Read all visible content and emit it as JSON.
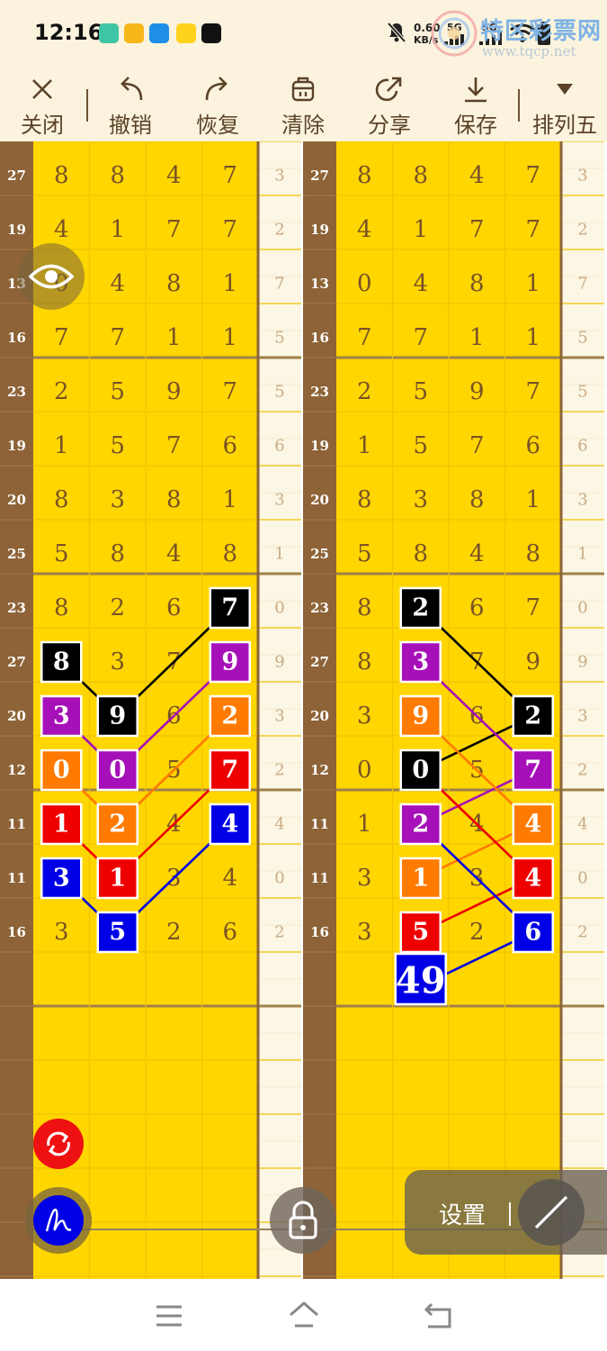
{
  "status": {
    "time": "12:16",
    "net_speed_top": "0.60",
    "net_speed_unit": "KB/s",
    "net_type_1": "5G",
    "net_type_2": "5G"
  },
  "watermark": {
    "title": "特区彩票网",
    "url": "www.tqcp.net"
  },
  "toolbar": {
    "close": "关闭",
    "undo": "撤销",
    "redo": "恢复",
    "clear": "清除",
    "share": "分享",
    "save": "保存",
    "lottery": "排列五"
  },
  "colors": {
    "board_yellow": "#ffd600",
    "label_brown": "#8a6030",
    "digit_brown": "#7a5226",
    "black": "#000000",
    "purple": "#a610b8",
    "orange": "#ff7a00",
    "red": "#ee0000",
    "blue": "#0000e6"
  },
  "grid": {
    "rows": [
      {
        "label": "27",
        "digits": [
          "8",
          "8",
          "4",
          "7"
        ],
        "tail": "3"
      },
      {
        "label": "19",
        "digits": [
          "4",
          "1",
          "7",
          "7"
        ],
        "tail": "2"
      },
      {
        "label": "13",
        "digits": [
          "0",
          "4",
          "8",
          "1"
        ],
        "tail": "7"
      },
      {
        "label": "16",
        "digits": [
          "7",
          "7",
          "1",
          "1"
        ],
        "tail": "5"
      },
      {
        "label": "23",
        "digits": [
          "2",
          "5",
          "9",
          "7"
        ],
        "tail": "5"
      },
      {
        "label": "19",
        "digits": [
          "1",
          "5",
          "7",
          "6"
        ],
        "tail": "6"
      },
      {
        "label": "20",
        "digits": [
          "8",
          "3",
          "8",
          "1"
        ],
        "tail": "3"
      },
      {
        "label": "25",
        "digits": [
          "5",
          "8",
          "4",
          "8"
        ],
        "tail": "1"
      },
      {
        "label": "23",
        "digits": [
          "8",
          "2",
          "6",
          "7"
        ],
        "tail": "0"
      },
      {
        "label": "27",
        "digits": [
          "8",
          "3",
          "7",
          "9"
        ],
        "tail": "9"
      },
      {
        "label": "20",
        "digits": [
          "3",
          "9",
          "6",
          "2"
        ],
        "tail": "3"
      },
      {
        "label": "12",
        "digits": [
          "0",
          "0",
          "5",
          "7"
        ],
        "tail": "2"
      },
      {
        "label": "11",
        "digits": [
          "1",
          "2",
          "4",
          "4"
        ],
        "tail": "4"
      },
      {
        "label": "11",
        "digits": [
          "3",
          "1",
          "3",
          "4"
        ],
        "tail": "0"
      },
      {
        "label": "16",
        "digits": [
          "3",
          "5",
          "2",
          "6"
        ],
        "tail": "2"
      }
    ]
  },
  "panel1": {
    "boxes": [
      {
        "row": 8,
        "col": 3,
        "value": "7",
        "color": "black"
      },
      {
        "row": 9,
        "col": 0,
        "value": "8",
        "color": "black"
      },
      {
        "row": 9,
        "col": 3,
        "value": "9",
        "color": "purple"
      },
      {
        "row": 10,
        "col": 0,
        "value": "3",
        "color": "purple"
      },
      {
        "row": 10,
        "col": 1,
        "value": "9",
        "color": "black"
      },
      {
        "row": 10,
        "col": 3,
        "value": "2",
        "color": "orange"
      },
      {
        "row": 11,
        "col": 0,
        "value": "0",
        "color": "orange"
      },
      {
        "row": 11,
        "col": 1,
        "value": "0",
        "color": "purple"
      },
      {
        "row": 11,
        "col": 3,
        "value": "7",
        "color": "red"
      },
      {
        "row": 12,
        "col": 0,
        "value": "1",
        "color": "red"
      },
      {
        "row": 12,
        "col": 1,
        "value": "2",
        "color": "orange"
      },
      {
        "row": 12,
        "col": 3,
        "value": "4",
        "color": "blue"
      },
      {
        "row": 13,
        "col": 0,
        "value": "3",
        "color": "blue"
      },
      {
        "row": 13,
        "col": 1,
        "value": "1",
        "color": "red"
      },
      {
        "row": 14,
        "col": 1,
        "value": "5",
        "color": "blue"
      }
    ],
    "lines": [
      {
        "color": "black",
        "path": [
          [
            9,
            0
          ],
          [
            10,
            1
          ],
          [
            8,
            3
          ]
        ]
      },
      {
        "color": "purple",
        "path": [
          [
            10,
            0
          ],
          [
            11,
            1
          ],
          [
            9,
            3
          ]
        ]
      },
      {
        "color": "orange",
        "path": [
          [
            11,
            0
          ],
          [
            12,
            1
          ],
          [
            10,
            3
          ]
        ]
      },
      {
        "color": "red",
        "path": [
          [
            12,
            0
          ],
          [
            13,
            1
          ],
          [
            11,
            3
          ]
        ]
      },
      {
        "color": "blue",
        "path": [
          [
            13,
            0
          ],
          [
            14,
            1
          ],
          [
            12,
            3
          ]
        ]
      }
    ]
  },
  "panel2": {
    "boxes": [
      {
        "row": 8,
        "col": 1,
        "value": "2",
        "color": "black"
      },
      {
        "row": 9,
        "col": 1,
        "value": "3",
        "color": "purple"
      },
      {
        "row": 10,
        "col": 1,
        "value": "9",
        "color": "orange"
      },
      {
        "row": 10,
        "col": 3,
        "value": "2",
        "color": "black"
      },
      {
        "row": 11,
        "col": 1,
        "value": "0",
        "color": "black"
      },
      {
        "row": 11,
        "col": 3,
        "value": "7",
        "color": "purple"
      },
      {
        "row": 12,
        "col": 1,
        "value": "2",
        "color": "purple"
      },
      {
        "row": 12,
        "col": 3,
        "value": "4",
        "color": "orange"
      },
      {
        "row": 13,
        "col": 1,
        "value": "1",
        "color": "orange"
      },
      {
        "row": 13,
        "col": 3,
        "value": "4",
        "color": "red"
      },
      {
        "row": 14,
        "col": 1,
        "value": "5",
        "color": "red"
      },
      {
        "row": 14,
        "col": 3,
        "value": "6",
        "color": "blue"
      }
    ],
    "lines": [
      {
        "color": "black",
        "path": [
          [
            8,
            1
          ],
          [
            10,
            3
          ],
          [
            11,
            1
          ]
        ]
      },
      {
        "color": "purple",
        "path": [
          [
            9,
            1
          ],
          [
            11,
            3
          ],
          [
            12,
            1
          ]
        ]
      },
      {
        "color": "orange",
        "path": [
          [
            10,
            1
          ],
          [
            12,
            3
          ],
          [
            13,
            1
          ]
        ]
      },
      {
        "color": "red",
        "path": [
          [
            11,
            1
          ],
          [
            13,
            3
          ],
          [
            14,
            1
          ]
        ]
      },
      {
        "color": "blue",
        "path": [
          [
            12,
            1
          ],
          [
            14,
            3
          ],
          [
            15,
            1
          ]
        ]
      }
    ],
    "sum_box": {
      "value": "49",
      "color": "blue"
    }
  },
  "overlay": {
    "settings_label": "设置"
  }
}
